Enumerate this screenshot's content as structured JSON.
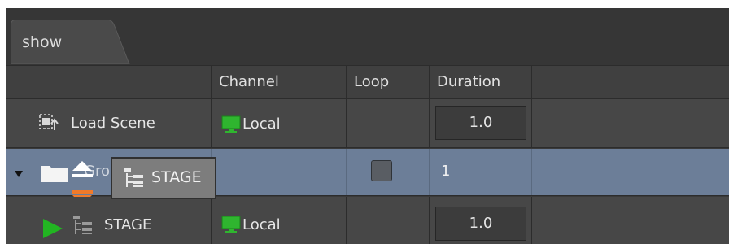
{
  "tab": {
    "label": "show"
  },
  "columns": {
    "name": "",
    "channel": "Channel",
    "loop": "Loop",
    "duration": "Duration"
  },
  "rows": [
    {
      "name": "Load Scene",
      "icon": "load-scene-icon",
      "channel": "Local",
      "channel_icon": "monitor-icon",
      "loop": null,
      "duration": "1.0"
    },
    {
      "name": "Gro",
      "icon": "folder-icon",
      "expanded": true,
      "channel": "",
      "loop": false,
      "duration": "1"
    },
    {
      "name": "STAGE",
      "icon": "stage-icon",
      "play_icon": "play-icon",
      "channel": "Local",
      "channel_icon": "monitor-icon",
      "loop": null,
      "duration": "1.0"
    }
  ],
  "drag": {
    "label": "STAGE",
    "icon": "stage-icon"
  },
  "colors": {
    "selection": "#6c7e98",
    "channel_green": "#2fb52f",
    "play_green": "#22b522",
    "drop_orange": "#f07a2a"
  }
}
